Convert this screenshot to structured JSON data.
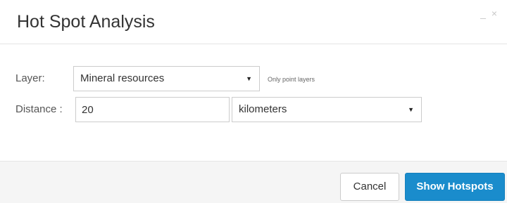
{
  "dialog": {
    "title": "Hot Spot Analysis",
    "minimize_glyph": "_",
    "close_glyph": "×"
  },
  "form": {
    "layer_label": "Layer:",
    "layer_value": "Mineral resources",
    "layer_hint": "Only point layers",
    "distance_label": "Distance :",
    "distance_value": "20",
    "unit_value": "kilometers",
    "caret_glyph": "▼"
  },
  "footer": {
    "cancel_label": "Cancel",
    "submit_label": "Show Hotspots"
  },
  "colors": {
    "primary_button": "#1a8ccc",
    "footer_background": "#f5f5f5"
  }
}
